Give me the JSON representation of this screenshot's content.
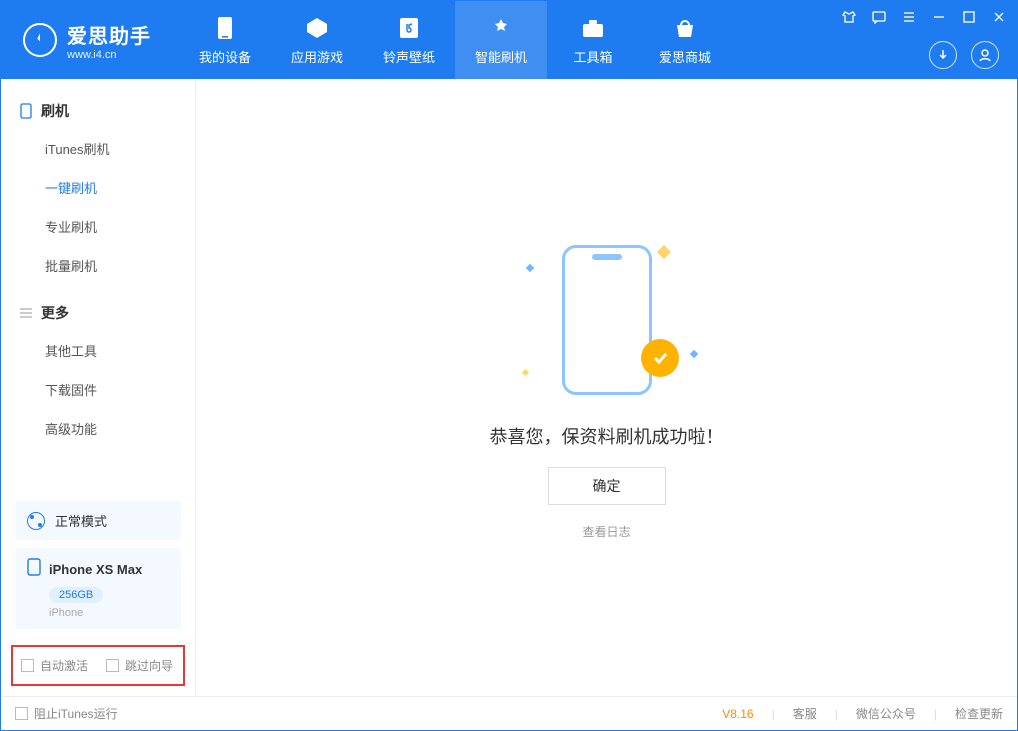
{
  "app": {
    "title": "爱思助手",
    "url": "www.i4.cn"
  },
  "tabs": {
    "device": "我的设备",
    "apps": "应用游戏",
    "ringtones": "铃声壁纸",
    "flash": "智能刷机",
    "toolbox": "工具箱",
    "store": "爱思商城"
  },
  "sidebar": {
    "group_flash": "刷机",
    "items_flash": {
      "itunes": "iTunes刷机",
      "oneclick": "一键刷机",
      "pro": "专业刷机",
      "batch": "批量刷机"
    },
    "group_more": "更多",
    "items_more": {
      "other": "其他工具",
      "firmware": "下载固件",
      "advanced": "高级功能"
    }
  },
  "mode": {
    "label": "正常模式"
  },
  "device": {
    "name": "iPhone XS Max",
    "storage": "256GB",
    "type": "iPhone"
  },
  "options": {
    "auto_activate": "自动激活",
    "skip_guide": "跳过向导"
  },
  "main": {
    "success": "恭喜您，保资料刷机成功啦！",
    "ok": "确定",
    "view_log": "查看日志"
  },
  "footer": {
    "block_itunes": "阻止iTunes运行",
    "version": "V8.16",
    "support": "客服",
    "wechat": "微信公众号",
    "update": "检查更新"
  }
}
